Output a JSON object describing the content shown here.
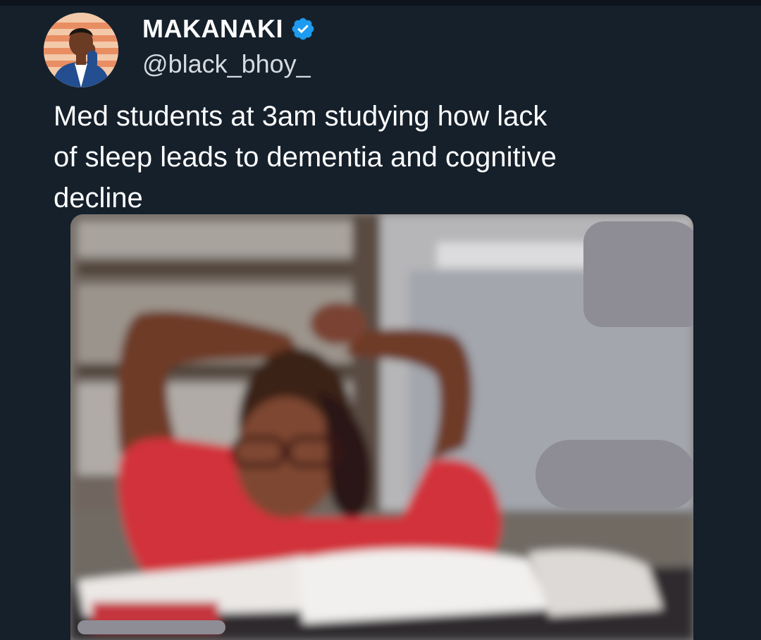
{
  "tweet": {
    "display_name": "MAKANAKI",
    "handle": "@black_bhoy_",
    "verified": true,
    "text_lines": [
      "Med students at 3am studying how lack",
      "of sleep leads to  dementia and cognitive",
      "decline"
    ]
  },
  "colors": {
    "background": "#15202b",
    "text": "#ffffff",
    "secondary_text": "#d6dbe0",
    "verified_badge": "#1d9bf0",
    "redaction": "#8e8d95"
  },
  "icons": {
    "verified": "verified-badge-icon",
    "avatar": "user-avatar"
  }
}
